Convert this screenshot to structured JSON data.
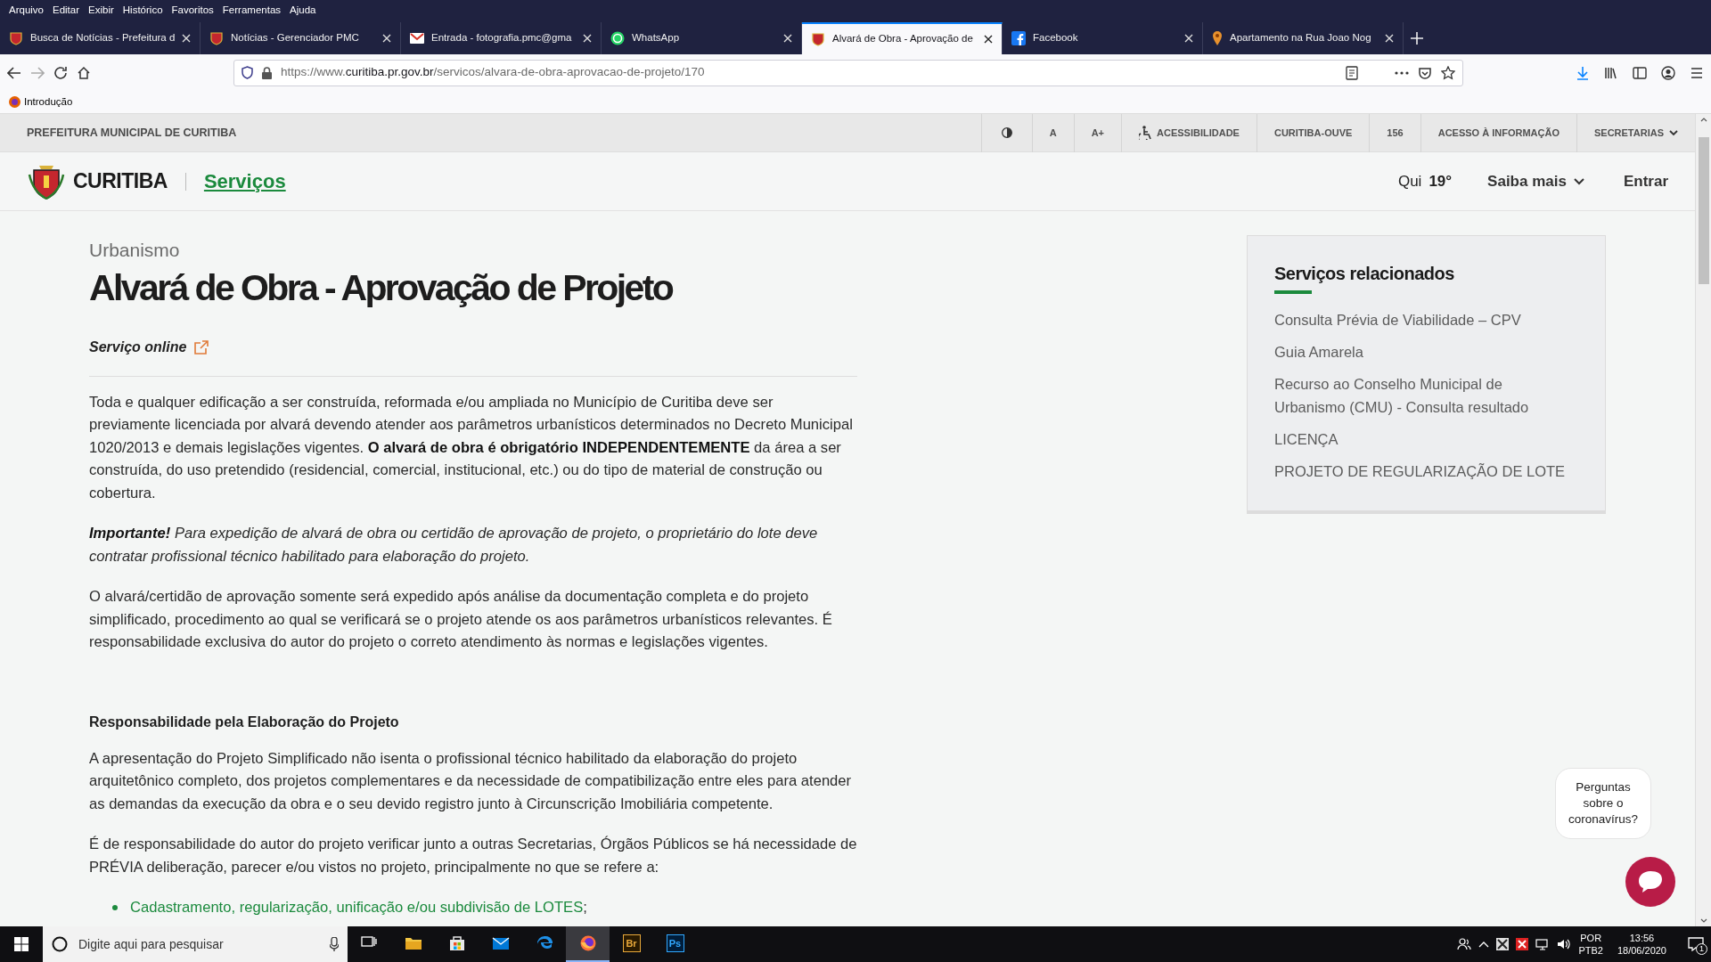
{
  "menu_bar": [
    "Arquivo",
    "Editar",
    "Exibir",
    "Histórico",
    "Favoritos",
    "Ferramentas",
    "Ajuda"
  ],
  "tabs": [
    {
      "title": "Busca de Notícias - Prefeitura d",
      "kind": "crest",
      "selected": false
    },
    {
      "title": "Notícias - Gerenciador PMC",
      "kind": "crest",
      "selected": false
    },
    {
      "title": "Entrada - fotografia.pmc@gma",
      "kind": "mail",
      "selected": false
    },
    {
      "title": "WhatsApp",
      "kind": "whatsapp",
      "selected": false
    },
    {
      "title": "Alvará de Obra - Aprovação de",
      "kind": "crest",
      "selected": true
    },
    {
      "title": "Facebook",
      "kind": "facebook",
      "selected": false
    },
    {
      "title": "Apartamento na Rua Joao Nog",
      "kind": "pin",
      "selected": false
    }
  ],
  "address_bar": {
    "url_start": "https://www.",
    "url_domain": "curitiba.pr.gov.br",
    "url_path": "/servicos/alvara-de-obra-aprovacao-de-projeto/170"
  },
  "bookmarks": [
    "Introdução"
  ],
  "site_topbar": {
    "brand": "PREFEITURA MUNICIPAL DE CURITIBA",
    "items": [
      {
        "kind": "contrast"
      },
      {
        "kind": "text",
        "label": "A"
      },
      {
        "kind": "text",
        "label": "A+"
      },
      {
        "kind": "accessibility",
        "label": "ACESSIBILIDADE"
      },
      {
        "kind": "text",
        "label": "CURITIBA-OUVE"
      },
      {
        "kind": "text",
        "label": "156"
      },
      {
        "kind": "text",
        "label": "ACESSO À INFORMAÇÃO"
      },
      {
        "kind": "dropdown",
        "label": "SECRETARIAS"
      }
    ]
  },
  "site_header": {
    "logo_text": "CURITIBA",
    "section": "Serviços",
    "weather_day": "Qui",
    "temperature": "19°",
    "more_menu": "Saiba mais",
    "login": "Entrar"
  },
  "content": {
    "category": "Urbanismo",
    "title": "Alvará de Obra - Aprovação de Projeto",
    "online_link": "Serviço online",
    "blocks": [
      {
        "kind": "paragraph",
        "text": "Toda e qualquer edificação a ser construída, reformada e/ou ampliada no Município de Curitiba deve ser previamente licenciada por alvará devendo atender aos parâmetros urbanísticos determinados no Decreto Municipal 1020/2013 e demais legislações vigentes. **O alvará de obra é obrigatório INDEPENDENTEMENTE** da área a ser construída, do uso pretendido (residencial, comercial, institucional, etc.) ou do tipo de material de construção ou cobertura."
      },
      {
        "kind": "note",
        "text": "**Importante!** Para expedição de alvará de obra ou certidão de aprovação de projeto, o proprietário do lote deve contratar profissional técnico habilitado para elaboração do projeto."
      },
      {
        "kind": "paragraph",
        "text": "O alvará/certidão de aprovação somente será expedido após análise da documentação completa e do projeto simplificado, procedimento ao qual se verificará se o projeto atende os aos parâmetros urbanísticos relevantes. É responsabilidade exclusiva do autor do projeto o correto atendimento às normas e legislações vigentes."
      },
      {
        "kind": "heading",
        "text": "Responsabilidade pela Elaboração do Projeto"
      },
      {
        "kind": "paragraph",
        "text": "A apresentação do Projeto Simplificado não isenta o profissional técnico habilitado da elaboração do projeto arquitetônico completo, dos projetos complementares e da necessidade de compatibilização entre eles para atender as demandas da execução da obra e o seu devido registro junto à Circunscrição Imobiliária competente."
      },
      {
        "kind": "paragraph",
        "text": "É de responsabilidade do autor do projeto verificar junto a outras Secretarias, Órgãos Públicos se há necessidade de PRÉVIA deliberação, parecer e/ou vistos no projeto, principalmente no que se refere a:"
      },
      {
        "kind": "list",
        "items": [
          {
            "link": "Cadastramento, regularização, unificação e/ou subdivisão de LOTES",
            "text": ";"
          }
        ]
      }
    ]
  },
  "sidebar": {
    "title": "Serviços relacionados",
    "items": [
      "Consulta Prévia de Viabilidade – CPV",
      "Guia Amarela",
      "Recurso ao Conselho Municipal de Urbanismo (CMU) - Consulta resultado",
      "LICENÇA",
      "PROJETO DE REGULARIZAÇÃO DE LOTE"
    ]
  },
  "chat": {
    "bubble": "Perguntas sobre o coronavírus?"
  },
  "taskbar": {
    "search_placeholder": "Digite aqui para pesquisar",
    "apps": [
      {
        "kind": "taskview",
        "selected": false
      },
      {
        "kind": "explorer",
        "selected": false
      },
      {
        "kind": "store",
        "selected": false
      },
      {
        "kind": "mail",
        "selected": false
      },
      {
        "kind": "edge",
        "selected": false
      },
      {
        "kind": "firefox",
        "selected": true
      },
      {
        "kind": "bridge",
        "label": "Br",
        "selected": false
      },
      {
        "kind": "photoshop",
        "label": "Ps",
        "selected": false
      }
    ],
    "language": "POR",
    "layout": "PTB2",
    "time": "13:56",
    "date": "18/06/2020",
    "notifications": "1"
  }
}
